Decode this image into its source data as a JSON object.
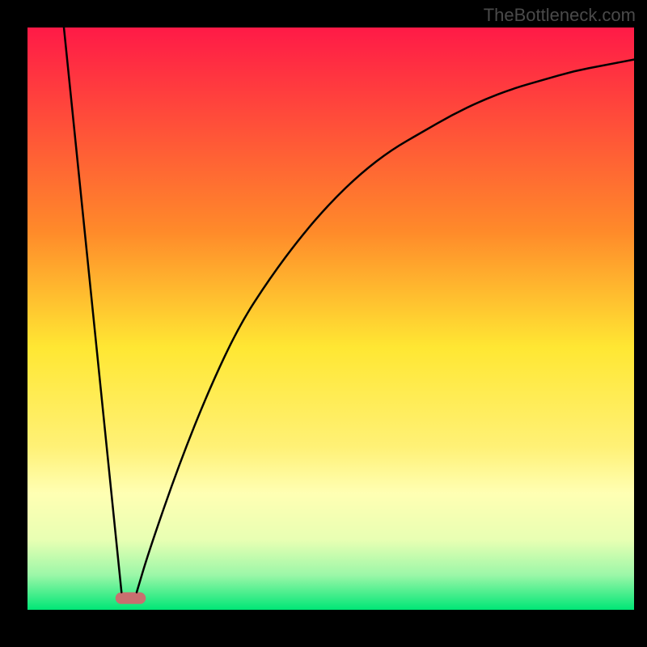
{
  "watermark": "TheBottleneck.com",
  "chart_data": {
    "type": "line",
    "title": "",
    "xlabel": "",
    "ylabel": "",
    "xlim": [
      0,
      100
    ],
    "ylim": [
      0,
      100
    ],
    "background_gradient": {
      "stops": [
        {
          "offset": 0,
          "color": "#ff1a47"
        },
        {
          "offset": 35,
          "color": "#ff8a2a"
        },
        {
          "offset": 55,
          "color": "#ffe733"
        },
        {
          "offset": 72,
          "color": "#fff176"
        },
        {
          "offset": 80,
          "color": "#ffffb3"
        },
        {
          "offset": 88,
          "color": "#e8ffb3"
        },
        {
          "offset": 94,
          "color": "#9cf7a8"
        },
        {
          "offset": 100,
          "color": "#00e676"
        }
      ]
    },
    "series": [
      {
        "name": "left-branch",
        "x": [
          6,
          15.5
        ],
        "values": [
          100,
          3
        ]
      },
      {
        "name": "right-branch",
        "x": [
          18,
          20,
          25,
          30,
          35,
          40,
          45,
          50,
          55,
          60,
          65,
          70,
          75,
          80,
          85,
          90,
          95,
          100
        ],
        "values": [
          3,
          10,
          25,
          38,
          49,
          57,
          64,
          70,
          75,
          79,
          82,
          85,
          87.5,
          89.5,
          91,
          92.5,
          93.5,
          94.5
        ]
      }
    ],
    "marker": {
      "x": 17,
      "y": 2,
      "width": 5,
      "height": 2,
      "color": "#c96f6f"
    }
  }
}
